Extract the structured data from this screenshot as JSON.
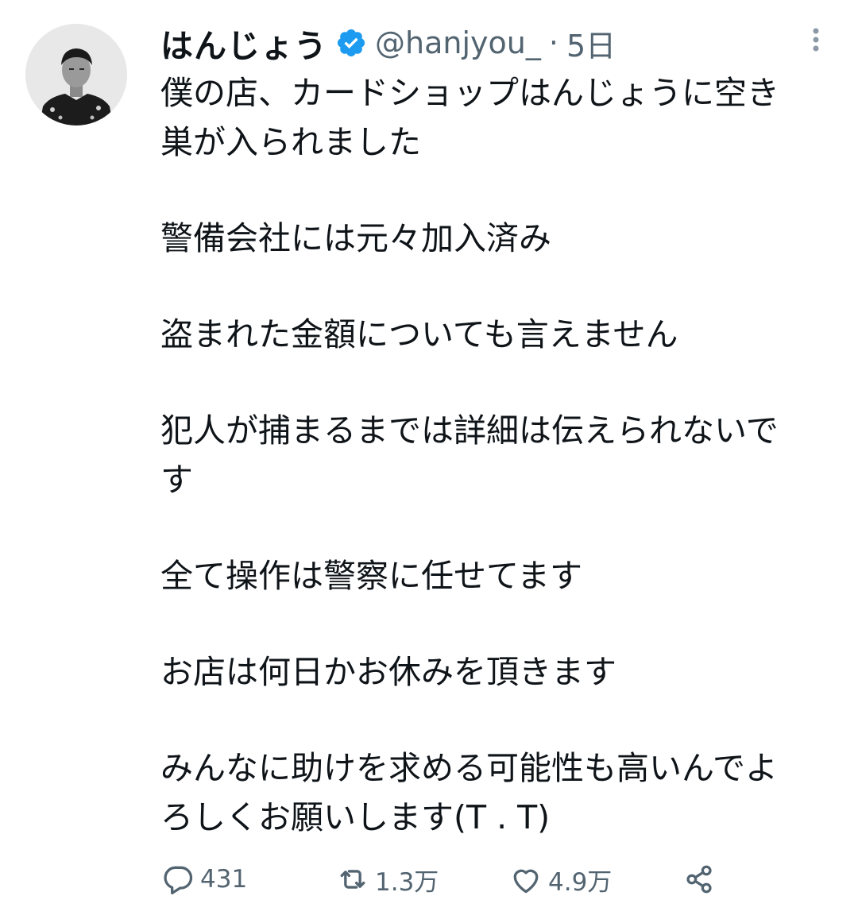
{
  "tweet": {
    "author": {
      "display_name": "はんじょう",
      "handle": "@hanjyou_",
      "verified": true,
      "avatar_icon": "avatar-photo"
    },
    "separator": "·",
    "timestamp": "5日",
    "more_icon": "more-vertical-icon",
    "paragraphs": [
      {
        "lines": [
          "僕の店、カードショップはんじょうに空き",
          "巣が入られました"
        ]
      },
      {
        "lines": [
          "警備会社には元々加入済み"
        ]
      },
      {
        "lines": [
          "盗まれた金額についても言えません"
        ]
      },
      {
        "lines": [
          "犯人が捕まるまでは詳細は伝えられないで",
          "す"
        ]
      },
      {
        "lines": [
          "全て操作は警察に任せてます"
        ]
      },
      {
        "lines": [
          "お店は何日かお休みを頂きます"
        ]
      },
      {
        "lines": [
          "みんなに助けを求める可能性も高いんでよ",
          "ろしくお願いします(T . T)"
        ]
      }
    ],
    "actions": {
      "reply_count": "431",
      "retweet_count": "1.3万",
      "like_count": "4.9万",
      "share_icon": "share-icon"
    }
  },
  "colors": {
    "text": "#0f1419",
    "secondary": "#536471",
    "verified_badge": "#1d9bf0",
    "background": "#ffffff"
  }
}
